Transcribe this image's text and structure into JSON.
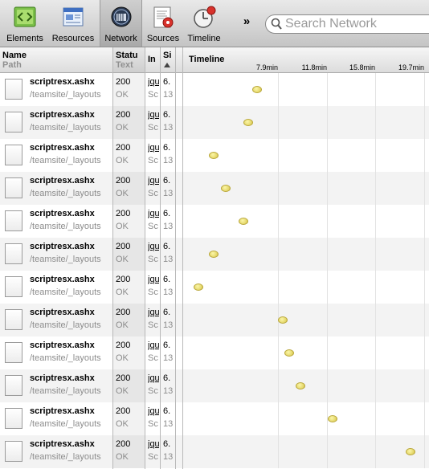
{
  "toolbar": {
    "items": [
      {
        "label": "Elements",
        "icon": "elements-icon"
      },
      {
        "label": "Resources",
        "icon": "resources-icon"
      },
      {
        "label": "Network",
        "icon": "network-icon",
        "selected": true
      },
      {
        "label": "Sources",
        "icon": "sources-icon"
      },
      {
        "label": "Timeline",
        "icon": "timeline-icon"
      }
    ],
    "overflow_label": "»",
    "search_placeholder": "Search Network"
  },
  "columns": {
    "name": {
      "title": "Name",
      "subtitle": "Path"
    },
    "status": {
      "title": "Statu",
      "subtitle": "Text"
    },
    "initiator": {
      "title": "In"
    },
    "size": {
      "title": "Si"
    },
    "timeline": {
      "title": "Timeline"
    }
  },
  "timeline_ticks": [
    "7.9min",
    "11.8min",
    "15.8min",
    "19.7min"
  ],
  "requests": [
    {
      "name": "scriptresx.ashx",
      "path": "/teamsite/_layouts",
      "status": "200",
      "status_text": "OK",
      "initiator": "jqu",
      "initiator_type": "Sc",
      "size": "6.",
      "size_content": "13",
      "dot_fraction": 0.29
    },
    {
      "name": "scriptresx.ashx",
      "path": "/teamsite/_layouts",
      "status": "200",
      "status_text": "OK",
      "initiator": "jqu",
      "initiator_type": "Sc",
      "size": "6.",
      "size_content": "13",
      "dot_fraction": 0.25
    },
    {
      "name": "scriptresx.ashx",
      "path": "/teamsite/_layouts",
      "status": "200",
      "status_text": "OK",
      "initiator": "jqu",
      "initiator_type": "Sc",
      "size": "6.",
      "size_content": "13",
      "dot_fraction": 0.1
    },
    {
      "name": "scriptresx.ashx",
      "path": "/teamsite/_layouts",
      "status": "200",
      "status_text": "OK",
      "initiator": "jqu",
      "initiator_type": "Sc",
      "size": "6.",
      "size_content": "13",
      "dot_fraction": 0.15
    },
    {
      "name": "scriptresx.ashx",
      "path": "/teamsite/_layouts",
      "status": "200",
      "status_text": "OK",
      "initiator": "jqu",
      "initiator_type": "Sc",
      "size": "6.",
      "size_content": "13",
      "dot_fraction": 0.23
    },
    {
      "name": "scriptresx.ashx",
      "path": "/teamsite/_layouts",
      "status": "200",
      "status_text": "OK",
      "initiator": "jqu",
      "initiator_type": "Sc",
      "size": "6.",
      "size_content": "13",
      "dot_fraction": 0.1
    },
    {
      "name": "scriptresx.ashx",
      "path": "/teamsite/_layouts",
      "status": "200",
      "status_text": "OK",
      "initiator": "jqu",
      "initiator_type": "Sc",
      "size": "6.",
      "size_content": "13",
      "dot_fraction": 0.03
    },
    {
      "name": "scriptresx.ashx",
      "path": "/teamsite/_layouts",
      "status": "200",
      "status_text": "OK",
      "initiator": "jqu",
      "initiator_type": "Sc",
      "size": "6.",
      "size_content": "13",
      "dot_fraction": 0.4
    },
    {
      "name": "scriptresx.ashx",
      "path": "/teamsite/_layouts",
      "status": "200",
      "status_text": "OK",
      "initiator": "jqu",
      "initiator_type": "Sc",
      "size": "6.",
      "size_content": "13",
      "dot_fraction": 0.43
    },
    {
      "name": "scriptresx.ashx",
      "path": "/teamsite/_layouts",
      "status": "200",
      "status_text": "OK",
      "initiator": "jqu",
      "initiator_type": "Sc",
      "size": "6.",
      "size_content": "13",
      "dot_fraction": 0.48
    },
    {
      "name": "scriptresx.ashx",
      "path": "/teamsite/_layouts",
      "status": "200",
      "status_text": "OK",
      "initiator": "jqu",
      "initiator_type": "Sc",
      "size": "6.",
      "size_content": "13",
      "dot_fraction": 0.62
    },
    {
      "name": "scriptresx.ashx",
      "path": "/teamsite/_layouts",
      "status": "200",
      "status_text": "OK",
      "initiator": "jqu",
      "initiator_type": "Sc",
      "size": "6.",
      "size_content": "13",
      "dot_fraction": 0.96
    }
  ],
  "colors": {
    "toolbar_top": "#e9e9e9",
    "toolbar_bottom": "#c4c4c4",
    "dot_fill": "#f1e98a",
    "row_alt": "#f3f3f3"
  }
}
